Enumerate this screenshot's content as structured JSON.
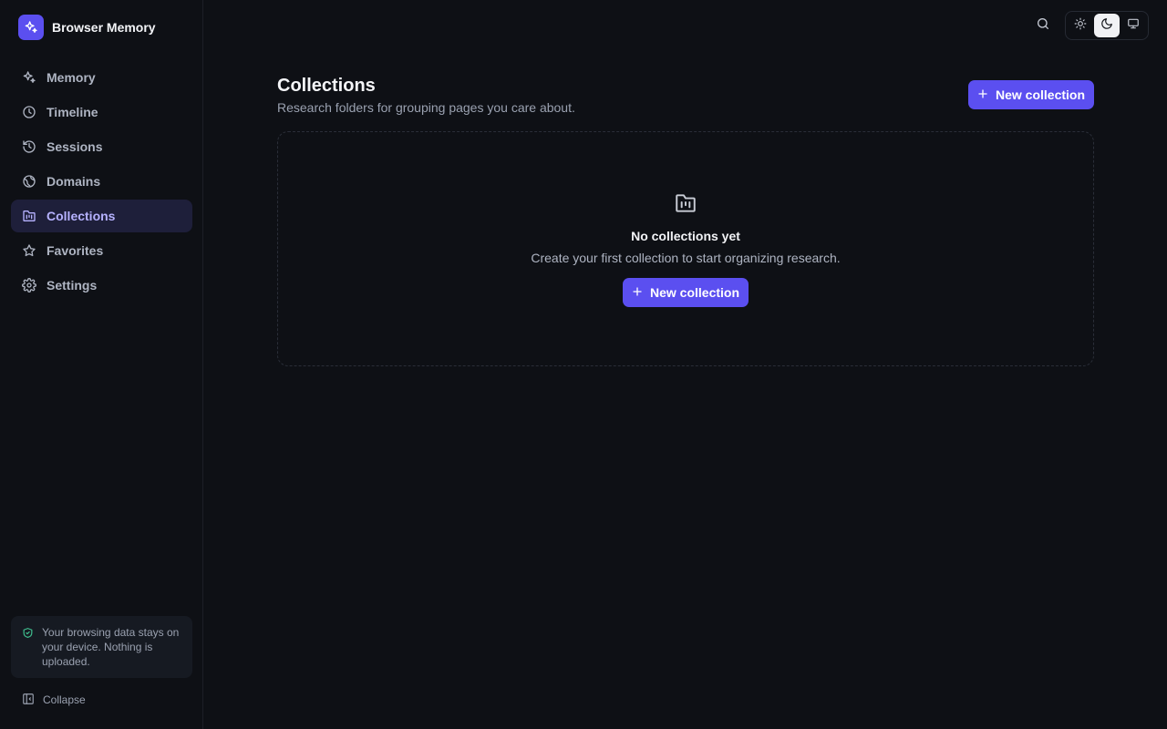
{
  "app": {
    "name": "Browser Memory"
  },
  "sidebar": {
    "items": [
      {
        "label": "Memory",
        "icon": "sparkles-icon",
        "active": false
      },
      {
        "label": "Timeline",
        "icon": "clock-icon",
        "active": false
      },
      {
        "label": "Sessions",
        "icon": "history-icon",
        "active": false
      },
      {
        "label": "Domains",
        "icon": "globe-icon",
        "active": false
      },
      {
        "label": "Collections",
        "icon": "folder-kanban-icon",
        "active": true
      },
      {
        "label": "Favorites",
        "icon": "star-icon",
        "active": false
      },
      {
        "label": "Settings",
        "icon": "gear-icon",
        "active": false
      }
    ],
    "privacy_note": "Your browsing data stays on your device. Nothing is uploaded.",
    "collapse_label": "Collapse"
  },
  "topbar": {
    "theme_options": [
      "light",
      "dark",
      "system"
    ],
    "theme_selected": "dark"
  },
  "main": {
    "title": "Collections",
    "subtitle": "Research folders for grouping pages you care about.",
    "new_button_label": "New collection",
    "empty_state": {
      "title": "No collections yet",
      "description": "Create your first collection to start organizing research.",
      "button_label": "New collection"
    }
  },
  "colors": {
    "background": "#0e1015",
    "accent": "#5b4ff0",
    "active_nav_bg": "#1e1f3a",
    "active_nav_text": "#b6b2ff",
    "privacy_shield": "#3fbf8f"
  }
}
